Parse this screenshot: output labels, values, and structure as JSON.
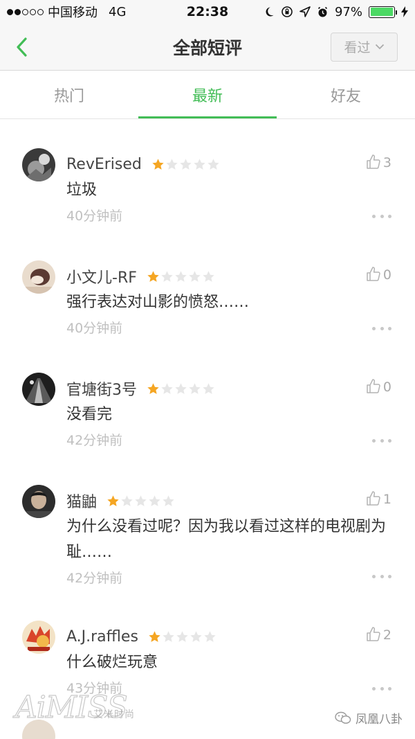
{
  "status_bar": {
    "carrier": "中国移动",
    "network": "4G",
    "time": "22:38",
    "battery_percent": "97%",
    "battery_level": 0.97,
    "signal_dots_filled": 2,
    "signal_dots_total": 5
  },
  "nav": {
    "title": "全部短评",
    "back_icon": "chevron-left-icon",
    "filter_label": "看过",
    "filter_icon": "chevron-down-icon"
  },
  "tabs": [
    {
      "label": "热门",
      "active": false
    },
    {
      "label": "最新",
      "active": true
    },
    {
      "label": "好友",
      "active": false
    }
  ],
  "reviews": [
    {
      "user": "RevErised",
      "rating": 1,
      "content": "垃圾",
      "time": "40分钟前",
      "likes": "3"
    },
    {
      "user": "小文儿-RF",
      "rating": 1,
      "content": "强行表达对山影的愤怒……",
      "time": "40分钟前",
      "likes": "0"
    },
    {
      "user": "官塘街3号",
      "rating": 1,
      "content": "没看完",
      "time": "42分钟前",
      "likes": "0"
    },
    {
      "user": "猫鼬",
      "rating": 1,
      "content": "为什么没看过呢？因为我以看过这样的电视剧为耻……",
      "time": "42分钟前",
      "likes": "1"
    },
    {
      "user": "A.J.raffles",
      "rating": 1,
      "content": "什么破烂玩意",
      "time": "43分钟前",
      "likes": "2"
    }
  ],
  "overlay": {
    "wechat_account": "凤凰八卦",
    "watermark": "AiMISS",
    "watermark_sub": "艾米时尚"
  },
  "colors": {
    "accent": "#42bd56",
    "star_on": "#f5a623",
    "star_off": "#e6e6e6"
  }
}
